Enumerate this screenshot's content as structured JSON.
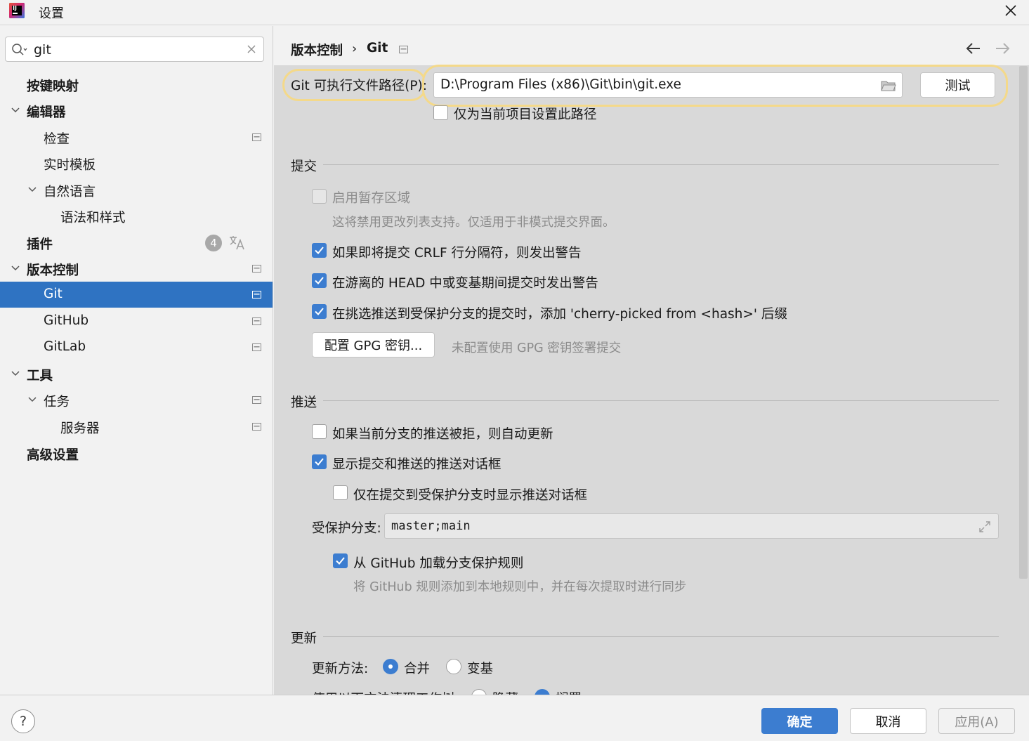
{
  "window": {
    "title": "设置",
    "logo_text": "IJ"
  },
  "search": {
    "value": "git"
  },
  "sidebar": {
    "items": [
      {
        "label": "按键映射"
      },
      {
        "label": "编辑器"
      },
      {
        "label": "检查"
      },
      {
        "label": "实时模板"
      },
      {
        "label": "自然语言"
      },
      {
        "label": "语法和样式"
      },
      {
        "label": "插件",
        "badge": "4"
      },
      {
        "label": "版本控制"
      },
      {
        "label": "Git"
      },
      {
        "label": "GitHub"
      },
      {
        "label": "GitLab"
      },
      {
        "label": "工具"
      },
      {
        "label": "任务"
      },
      {
        "label": "服务器"
      },
      {
        "label": "高级设置"
      }
    ]
  },
  "header": {
    "crumb1": "版本控制",
    "sep": "›",
    "crumb2": "Git"
  },
  "git_path": {
    "label": "Git 可执行文件路径(P):",
    "value": "D:\\Program Files (x86)\\Git\\bin\\git.exe",
    "test_button": "测试",
    "only_project": "仅为当前项目设置此路径"
  },
  "commit": {
    "title": "提交",
    "staging": "启用暂存区域",
    "staging_hint": "这将禁用更改列表支持。仅适用于非模式提交界面。",
    "crlf": "如果即将提交 CRLF 行分隔符，则发出警告",
    "detached": "在游离的 HEAD 中或变基期间提交时发出警告",
    "cherry": "在挑选推送到受保护分支的提交时，添加 'cherry-picked from <hash>' 后缀",
    "gpg_button": "配置 GPG 密钥...",
    "gpg_hint": "未配置使用 GPG 密钥签署提交"
  },
  "push": {
    "title": "推送",
    "auto_update": "如果当前分支的推送被拒，则自动更新",
    "show_dialog": "显示提交和推送的推送对话框",
    "only_protected": "仅在提交到受保护分支时显示推送对话框",
    "protected_label": "受保护分支:",
    "protected_value": "master;main",
    "load_github": "从 GitHub 加载分支保护规则",
    "load_github_hint": "将 GitHub 规则添加到本地规则中，并在每次提取时进行同步"
  },
  "update": {
    "title": "更新",
    "method_label": "更新方法:",
    "merge": "合并",
    "rebase": "变基",
    "partial_row": "使用以下方法清理工作树:",
    "partial_opt1": "隐藏",
    "partial_opt2": "搁置"
  },
  "footer": {
    "help": "?",
    "ok": "确定",
    "cancel": "取消",
    "apply": "应用(A)"
  },
  "colors": {
    "accent": "#3c7dd0",
    "selection": "#2f73c2",
    "highlight": "#f4d98a"
  }
}
